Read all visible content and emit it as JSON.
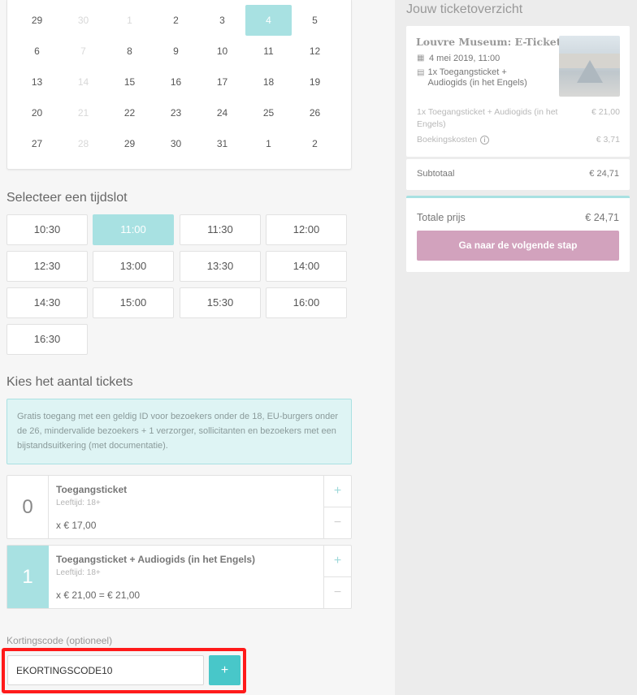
{
  "calendar": {
    "rows": [
      [
        {
          "d": "29",
          "dim": false
        },
        {
          "d": "30",
          "dim": true
        },
        {
          "d": "1",
          "dim": true
        },
        {
          "d": "2",
          "dim": false
        },
        {
          "d": "3",
          "dim": false
        },
        {
          "d": "4",
          "dim": false,
          "selected": true
        },
        {
          "d": "5",
          "dim": false
        }
      ],
      [
        {
          "d": "6",
          "dim": false
        },
        {
          "d": "7",
          "dim": true
        },
        {
          "d": "8",
          "dim": false
        },
        {
          "d": "9",
          "dim": false
        },
        {
          "d": "10",
          "dim": false
        },
        {
          "d": "11",
          "dim": false
        },
        {
          "d": "12",
          "dim": false
        }
      ],
      [
        {
          "d": "13",
          "dim": false
        },
        {
          "d": "14",
          "dim": true
        },
        {
          "d": "15",
          "dim": false
        },
        {
          "d": "16",
          "dim": false
        },
        {
          "d": "17",
          "dim": false
        },
        {
          "d": "18",
          "dim": false
        },
        {
          "d": "19",
          "dim": false
        }
      ],
      [
        {
          "d": "20",
          "dim": false
        },
        {
          "d": "21",
          "dim": true
        },
        {
          "d": "22",
          "dim": false
        },
        {
          "d": "23",
          "dim": false
        },
        {
          "d": "24",
          "dim": false
        },
        {
          "d": "25",
          "dim": false
        },
        {
          "d": "26",
          "dim": false
        }
      ],
      [
        {
          "d": "27",
          "dim": false
        },
        {
          "d": "28",
          "dim": true
        },
        {
          "d": "29",
          "dim": false
        },
        {
          "d": "30",
          "dim": false
        },
        {
          "d": "31",
          "dim": false
        },
        {
          "d": "1",
          "dim": false
        },
        {
          "d": "2",
          "dim": false
        }
      ]
    ]
  },
  "timeslots": {
    "title": "Selecteer een tijdslot",
    "slots": [
      {
        "time": "10:30",
        "selected": false
      },
      {
        "time": "11:00",
        "selected": true
      },
      {
        "time": "11:30",
        "selected": false
      },
      {
        "time": "12:00",
        "selected": false
      },
      {
        "time": "12:30",
        "selected": false
      },
      {
        "time": "13:00",
        "selected": false
      },
      {
        "time": "13:30",
        "selected": false
      },
      {
        "time": "14:00",
        "selected": false
      },
      {
        "time": "14:30",
        "selected": false
      },
      {
        "time": "15:00",
        "selected": false
      },
      {
        "time": "15:30",
        "selected": false
      },
      {
        "time": "16:00",
        "selected": false
      },
      {
        "time": "16:30",
        "selected": false
      }
    ]
  },
  "tickets": {
    "title": "Kies het aantal tickets",
    "info": "Gratis toegang met een geldig ID voor bezoekers onder de 18, EU-burgers onder de 26, mindervalide bezoekers + 1 verzorger, sollicitanten en bezoekers met een bijstandsuitkering (met documentatie).",
    "items": [
      {
        "qty": "0",
        "name": "Toegangsticket",
        "age": "Leeftijd: 18+",
        "price": "x € 17,00",
        "plus": "+",
        "minus": "−"
      },
      {
        "qty": "1",
        "name": "Toegangsticket + Audiogids (in het Engels)",
        "age": "Leeftijd: 18+",
        "price": "x € 21,00 = € 21,00",
        "plus": "+",
        "minus": "−"
      }
    ]
  },
  "discount": {
    "label": "Kortingscode (optioneel)",
    "value": "EKORTINGSCODE10",
    "button": "+"
  },
  "overview": {
    "title": "Jouw ticketoverzicht",
    "museum": "Louvre Museum: E-Ticket",
    "date": "4 mei 2019, 11:00",
    "ticket_desc": "1x Toegangsticket + Audiogids (in het Engels)",
    "line_item": "1x Toegangsticket + Audiogids (in het Engels)",
    "line_amount": "€ 21,00",
    "booking_label": "Boekingskosten",
    "booking_amount": "€ 3,71",
    "subtotal_label": "Subtotaal",
    "subtotal_amount": "€ 24,71",
    "total_label": "Totale prijs",
    "total_amount": "€ 24,71",
    "next_button": "Ga naar de volgende stap"
  },
  "colors": {
    "accent": "#a8e1e2",
    "button_teal": "#48c7c9",
    "next_button": "#d2a2bd",
    "highlight": "#ff1a1a"
  }
}
